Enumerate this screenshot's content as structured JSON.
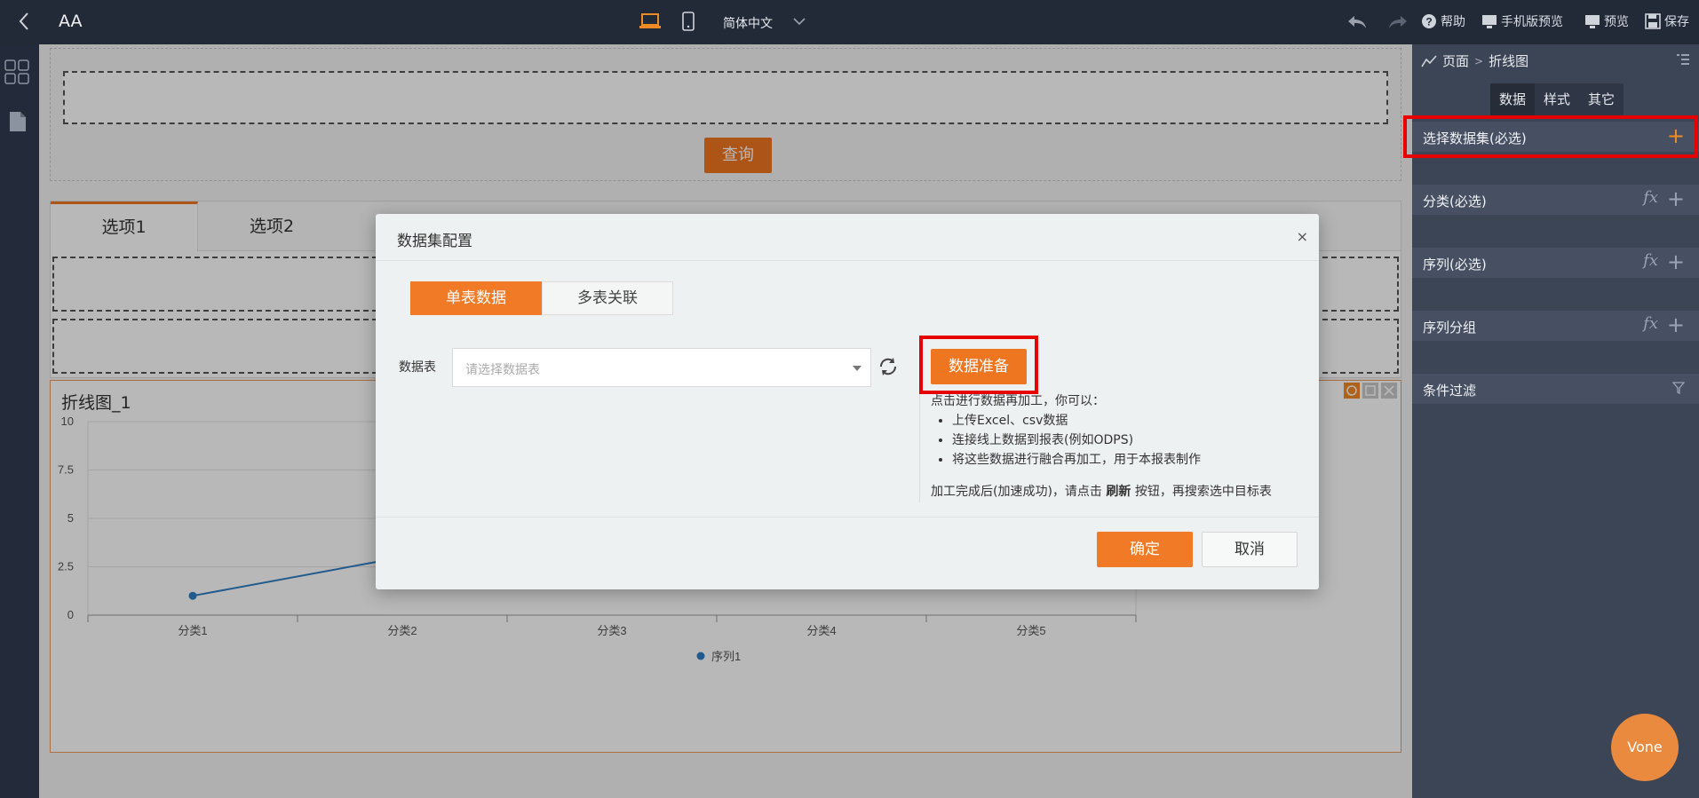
{
  "topbar": {
    "title": "AA",
    "language": "简体中文",
    "help": "帮助",
    "mobile_preview": "手机版预览",
    "preview": "预览",
    "save": "保存"
  },
  "canvas": {
    "query_button": "查询",
    "tabs": [
      {
        "label": "选项1"
      },
      {
        "label": "选项2"
      }
    ],
    "chart": {
      "title": "折线图_1"
    }
  },
  "chart_data": {
    "type": "line",
    "categories": [
      "分类1",
      "分类2",
      "分类3",
      "分类4",
      "分类5"
    ],
    "series": [
      {
        "name": "序列1",
        "values": [
          1,
          3,
          null,
          null,
          null
        ]
      }
    ],
    "y_ticks": [
      "0",
      "2.5",
      "5",
      "7.5",
      "10"
    ],
    "ylim": [
      0,
      10
    ],
    "grid": true,
    "legend_position": "bottom",
    "color": "#2f7fc4"
  },
  "right_panel": {
    "breadcrumb": [
      "页面",
      "折线图"
    ],
    "breadcrumb_sep": ">",
    "tabs": [
      {
        "label": "数据"
      },
      {
        "label": "样式"
      },
      {
        "label": "其它"
      }
    ],
    "sections": [
      {
        "label": "选择数据集(必选)"
      },
      {
        "label": "分类(必选)"
      },
      {
        "label": "序列(必选)"
      },
      {
        "label": "序列分组"
      },
      {
        "label": "条件过滤"
      }
    ],
    "fx": "fx"
  },
  "modal": {
    "title": "数据集配置",
    "close": "×",
    "segments": [
      {
        "label": "单表数据"
      },
      {
        "label": "多表关联"
      }
    ],
    "field_label": "数据表",
    "select_placeholder": "请选择数据表",
    "prep_button": "数据准备",
    "help_intro": "点击进行数据再加工，你可以：",
    "help_items": [
      "上传Excel、csv数据",
      "连接线上数据到报表(例如ODPS)",
      "将这些数据进行融合再加工，用于本报表制作"
    ],
    "help_done_prefix": "加工完成后(加速成功)，请点击 ",
    "help_done_bold": "刷新",
    "help_done_suffix": " 按钮，再搜索选中目标表",
    "ok": "确定",
    "cancel": "取消"
  },
  "floating": {
    "vone": "Vone"
  },
  "colors": {
    "accent": "#ef7621",
    "highlight": "#e60000",
    "panel": "#3c4555"
  }
}
